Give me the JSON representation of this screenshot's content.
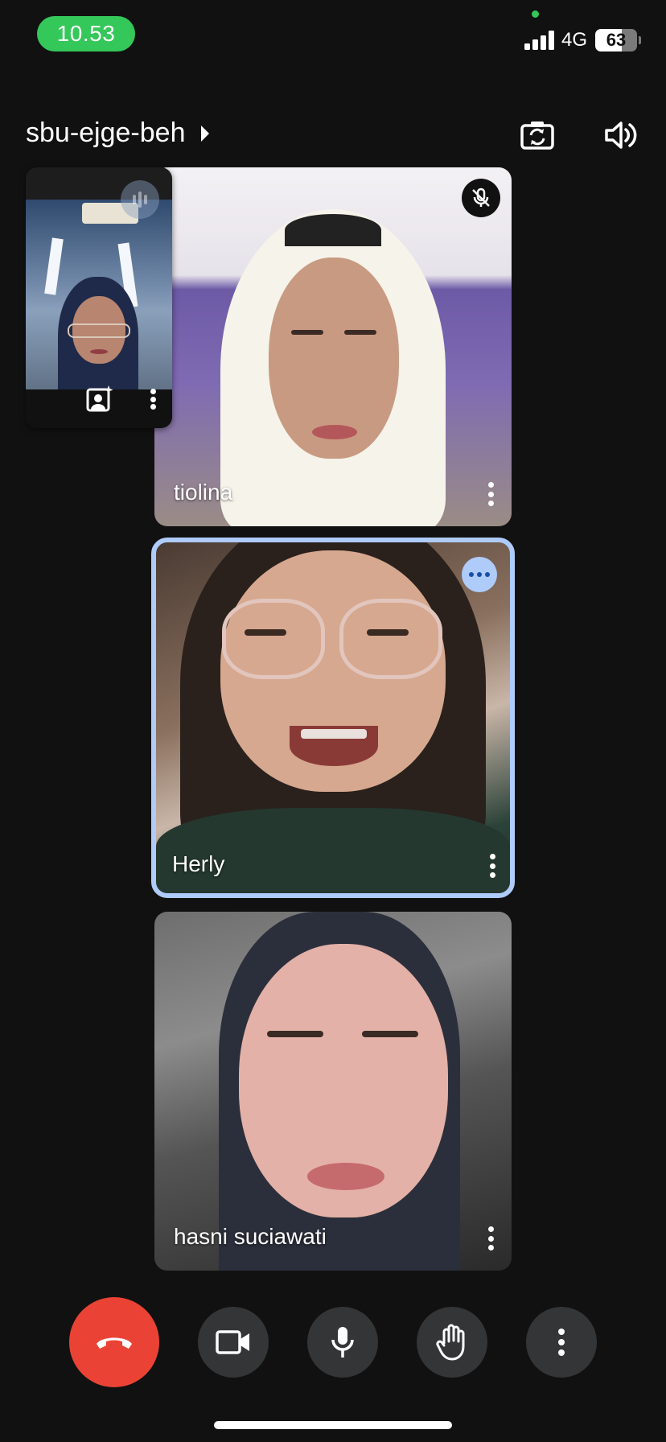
{
  "status_bar": {
    "time": "10.53",
    "network": "4G",
    "battery_level": "63",
    "battery_fraction": 0.63
  },
  "header": {
    "meeting_code": "sbu-ejge-beh",
    "switch_camera_icon": "camera-switch-icon",
    "audio_output_icon": "speaker-icon"
  },
  "participants": [
    {
      "name": "tiolina",
      "mic_muted": true
    },
    {
      "name": "Herly",
      "speaking": true
    },
    {
      "name": "hasni suciawati"
    }
  ],
  "self_view": {
    "icons": [
      "audio-level-icon",
      "effects-icon",
      "more-vert-icon"
    ]
  },
  "controls": {
    "end_call_icon": "call-end-icon",
    "camera_icon": "videocam-icon",
    "mic_icon": "mic-icon",
    "hand_icon": "raise-hand-icon",
    "more_icon": "more-vert-icon",
    "end_call_color": "#ea4335"
  },
  "colors": {
    "background": "#111111",
    "active_speaker_border": "#aecbfa",
    "status_time_pill": "#34c759"
  }
}
